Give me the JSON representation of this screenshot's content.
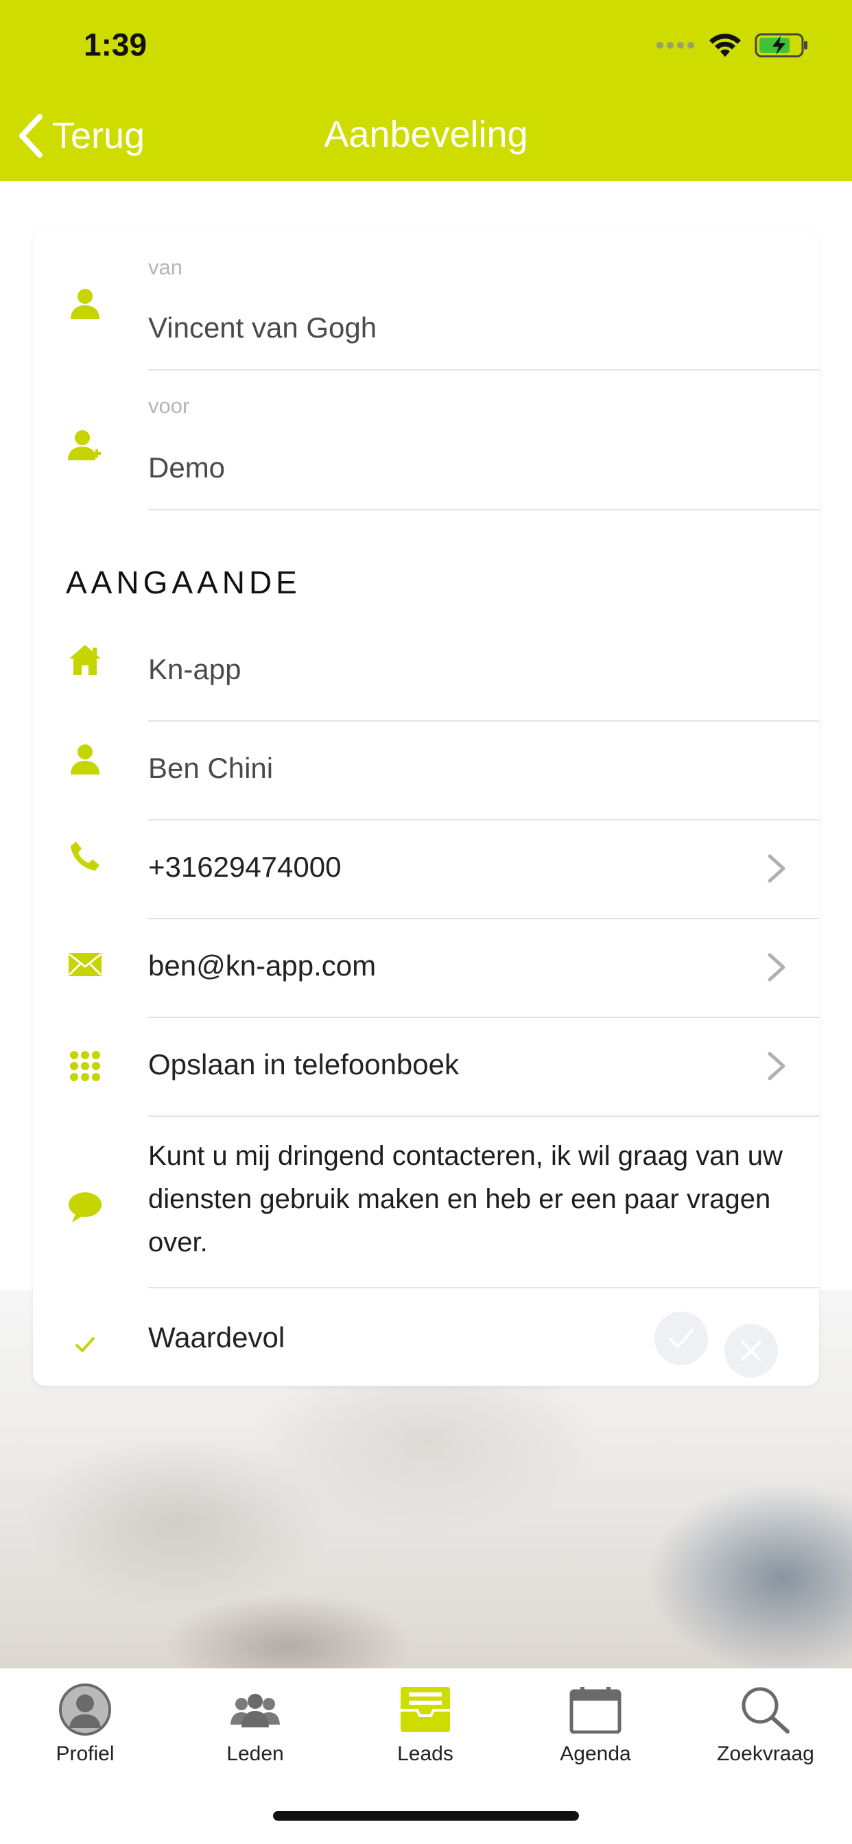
{
  "status_bar": {
    "time": "1:39"
  },
  "nav": {
    "back_label": "Terug",
    "title": "Aanbeveling"
  },
  "colors": {
    "accent": "#cfdc00",
    "icon": "#c6d400"
  },
  "from": {
    "label": "van",
    "value": "Vincent van Gogh"
  },
  "to": {
    "label": "voor",
    "value": "Demo"
  },
  "section_title": "AANGAANDE",
  "details": {
    "company": "Kn-app",
    "contact": "Ben Chini",
    "phone": "+31629474000",
    "email": "ben@kn-app.com",
    "save_contact": "Opslaan in telefoonboek",
    "message": "Kunt u mij dringend contacteren, ik wil graag van uw diensten gebruik maken en heb er een paar vragen over.",
    "valuable": "Waardevol"
  },
  "tabs": [
    {
      "label": "Profiel",
      "icon": "profile-icon",
      "active": false
    },
    {
      "label": "Leden",
      "icon": "members-icon",
      "active": false
    },
    {
      "label": "Leads",
      "icon": "leads-icon",
      "active": true
    },
    {
      "label": "Agenda",
      "icon": "calendar-icon",
      "active": false
    },
    {
      "label": "Zoekvraag",
      "icon": "search-icon",
      "active": false
    }
  ]
}
